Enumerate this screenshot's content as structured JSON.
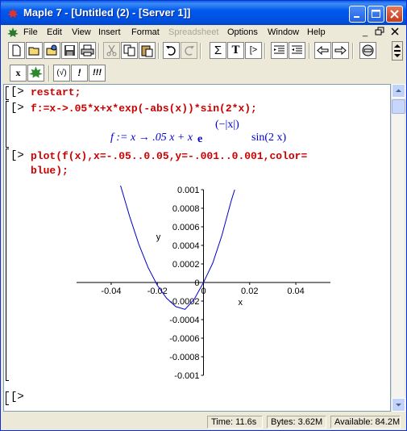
{
  "window": {
    "title": "Maple 7  - [Untitled (2) - [Server 1]]"
  },
  "menubar": {
    "items": [
      "File",
      "Edit",
      "View",
      "Insert",
      "Format",
      "Spreadsheet",
      "Options",
      "Window",
      "Help"
    ],
    "disabled": [
      "Spreadsheet"
    ]
  },
  "toolbar": {
    "icons": [
      "new-icon",
      "open-icon",
      "open-url-icon",
      "save-icon",
      "print-icon",
      "cut-icon",
      "copy-icon",
      "paste-icon",
      "undo-icon",
      "redo-icon",
      "sigma-icon",
      "text-icon",
      "prompt-icon",
      "indent-icon",
      "outdent-icon",
      "back-icon",
      "forward-icon",
      "stop-icon"
    ],
    "sigma_label": "Σ",
    "text_label": "T",
    "prompt_label": "[>"
  },
  "toolbar2": {
    "x_label": "x",
    "check_label": "(√)",
    "exec_label": "!",
    "execall_label": "!!!"
  },
  "worksheet": {
    "prompt": "[>",
    "line1": "restart;",
    "line2": "f:=x->.05*x+x*exp(-abs(x))*sin(2*x);",
    "output_lhs": "f := x → .05 x + x",
    "output_e": "e",
    "output_exp": "(−|x|)",
    "output_sin": "sin(2 x)",
    "line3a": "plot(f(x),x=-.05..0.05,y=-.001..0.001,color=",
    "line3b": "blue);",
    "last_prompt": "[>"
  },
  "chart_data": {
    "type": "line",
    "title": "",
    "xlabel": "x",
    "ylabel": "y",
    "xlim": [
      -0.055,
      0.055
    ],
    "ylim": [
      -0.001,
      0.001
    ],
    "x_ticks": [
      "-0.04",
      "-0.02",
      "0",
      "0.02",
      "0.04"
    ],
    "x_tick_values": [
      -0.04,
      -0.02,
      0,
      0.02,
      0.04
    ],
    "y_ticks": [
      "0.001",
      "0.0008",
      "0.0006",
      "0.0004",
      "0.0002",
      "0",
      "-0.0002",
      "-0.0004",
      "-0.0006",
      "-0.0008",
      "-0.001"
    ],
    "y_tick_values": [
      0.001,
      0.0008,
      0.0006,
      0.0004,
      0.0002,
      0,
      -0.0002,
      -0.0004,
      -0.0006,
      -0.0008,
      -0.001
    ],
    "series": [
      {
        "color": "#0000cc",
        "x": [
          -0.036,
          -0.032,
          -0.028,
          -0.024,
          -0.02,
          -0.016,
          -0.012,
          -0.008,
          -0.004,
          0,
          0.004,
          0.008,
          0.012,
          0.0135
        ],
        "y": [
          0.00105,
          0.00071,
          0.00041,
          0.00016,
          -3e-05,
          -0.00017,
          -0.00026,
          -0.00029,
          -0.00018,
          0,
          0.00021,
          0.00051,
          0.00088,
          0.001
        ]
      }
    ]
  },
  "status": {
    "time": "Time:  11.6s",
    "bytes": "Bytes: 3.62M",
    "available": "Available: 84.2M"
  },
  "colors": {
    "input": "#cc0000",
    "output": "#0000cc",
    "title_bar": "#0054e3"
  }
}
